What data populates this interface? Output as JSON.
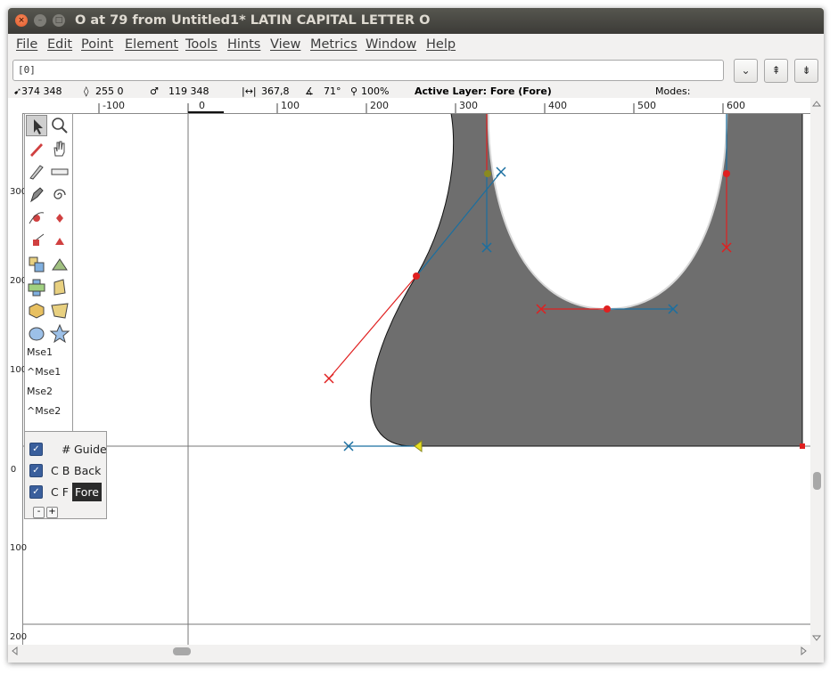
{
  "window": {
    "title": "O at 79 from Untitled1* LATIN CAPITAL LETTER O",
    "close_glyph": "×",
    "min_glyph": "–",
    "max_glyph": "□"
  },
  "menu": [
    "File",
    "Edit",
    "Point",
    "Element",
    "Tools",
    "Hints",
    "View",
    "Metrics",
    "Window",
    "Help"
  ],
  "command": {
    "value": "[0]",
    "btn_down": "⌄",
    "btn_up": "⇞",
    "btn_down2": "⇟"
  },
  "info": {
    "cursor_pos": "374 348",
    "point_pos": "255 0",
    "offset": "119 348",
    "distance": "367,8",
    "angle": "71°",
    "zoom": "100%",
    "active_layer": "Active Layer: Fore (Fore)",
    "modes": "Modes:"
  },
  "ruler": {
    "h_labels": [
      "-100",
      "0",
      "100",
      "200",
      "300",
      "400",
      "500",
      "600"
    ],
    "v_labels": [
      "300",
      "200",
      "100",
      "0",
      "100",
      "200"
    ]
  },
  "tools": {
    "mse1": "Mse1",
    "ctrl_mse1": "^Mse1",
    "mse2": "Mse2",
    "ctrl_mse2": "^Mse2"
  },
  "layers": {
    "rows": [
      {
        "prefix": "#",
        "name": "Guide",
        "checked": true
      },
      {
        "prefix": "C B",
        "name": "Back",
        "checked": true
      },
      {
        "prefix": "C F",
        "name": "Fore",
        "checked": true
      }
    ],
    "minus": "-",
    "plus": "+"
  },
  "colors": {
    "glyph_fill": "#6e6e6e",
    "spline_red": "#e02020",
    "spline_blue": "#1a6fa0",
    "selected_layer_bg": "#2b2b2b"
  }
}
